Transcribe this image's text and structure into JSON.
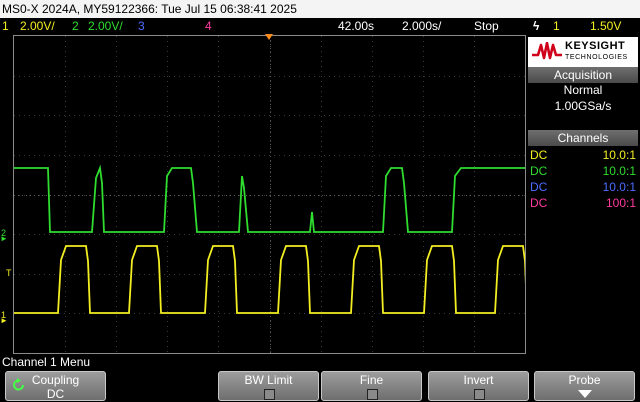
{
  "title_bar": "MS0-X 2024A, MY59122366: Tue Jul 15 06:38:41 2025",
  "status": {
    "ch1_num": "1",
    "ch1_scale": "2.00V/",
    "ch2_num": "2",
    "ch2_scale": "2.00V/",
    "ch3_num": "3",
    "ch4_num": "4",
    "time_pos": "42.00s",
    "time_scale": "2.000s/",
    "run_state": "Stop",
    "trigger_icon": "ϟ",
    "trig_ch": "1",
    "trig_level": "1.50V"
  },
  "markers": {
    "ch2": "2",
    "ch1": "1",
    "trig": "T"
  },
  "logo": {
    "brand": "KEYSIGHT",
    "sub": "TECHNOLOGIES"
  },
  "acquisition": {
    "title": "Acquisition",
    "mode": "Normal",
    "rate": "1.00GSa/s"
  },
  "channels_panel": {
    "title": "Channels",
    "rows": [
      {
        "coupling": "DC",
        "ratio": "10.0:1",
        "color": "#f2ee21"
      },
      {
        "coupling": "DC",
        "ratio": "10.0:1",
        "color": "#2fdc2f"
      },
      {
        "coupling": "DC",
        "ratio": "10.0:1",
        "color": "#4c6cff"
      },
      {
        "coupling": "DC",
        "ratio": "100:1",
        "color": "#ff3aa0"
      }
    ]
  },
  "menu": {
    "label": "Channel 1 Menu",
    "coupling_title": "Coupling",
    "coupling_value": "DC",
    "bw_limit": "BW Limit",
    "fine": "Fine",
    "invert": "Invert",
    "probe": "Probe"
  },
  "colors": {
    "ch1": "#f2ee21",
    "ch2": "#2fdc2f",
    "ch3": "#4c6cff",
    "ch4": "#ff3aa0",
    "trig_marker": "#ff8c1a"
  }
}
